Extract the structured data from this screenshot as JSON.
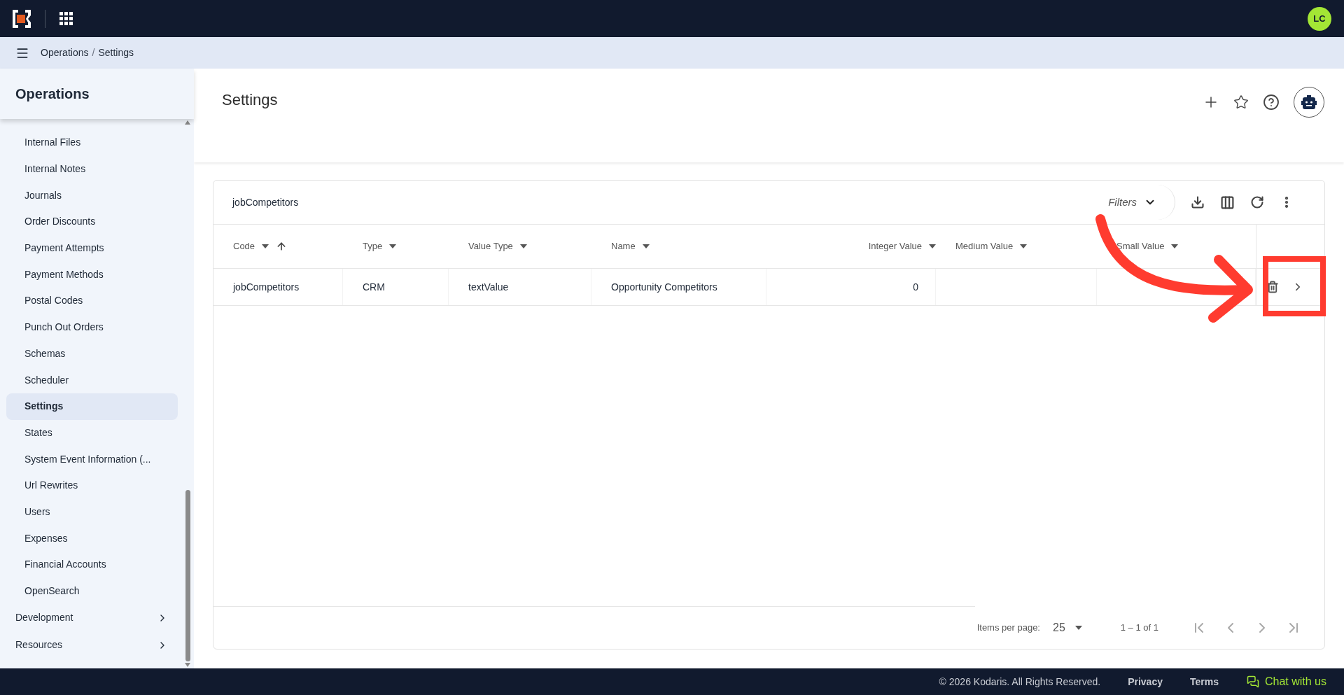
{
  "topbar": {
    "avatar": "LC"
  },
  "breadcrumb": {
    "items": [
      "Operations",
      "Settings"
    ],
    "separator": "/"
  },
  "sidebar": {
    "title": "Operations",
    "items": [
      {
        "label": "Internal Files",
        "selected": false
      },
      {
        "label": "Internal Notes",
        "selected": false
      },
      {
        "label": "Journals",
        "selected": false
      },
      {
        "label": "Order Discounts",
        "selected": false
      },
      {
        "label": "Payment Attempts",
        "selected": false
      },
      {
        "label": "Payment Methods",
        "selected": false
      },
      {
        "label": "Postal Codes",
        "selected": false
      },
      {
        "label": "Punch Out Orders",
        "selected": false
      },
      {
        "label": "Schemas",
        "selected": false
      },
      {
        "label": "Scheduler",
        "selected": false
      },
      {
        "label": "Settings",
        "selected": true
      },
      {
        "label": "States",
        "selected": false
      },
      {
        "label": "System Event Information (...",
        "selected": false
      },
      {
        "label": "Url Rewrites",
        "selected": false
      },
      {
        "label": "Users",
        "selected": false
      },
      {
        "label": "Expenses",
        "selected": false
      },
      {
        "label": "Financial Accounts",
        "selected": false
      },
      {
        "label": "OpenSearch",
        "selected": false
      }
    ],
    "sections": [
      {
        "label": "Development",
        "expanded": false
      },
      {
        "label": "Resources",
        "expanded": false
      }
    ]
  },
  "page": {
    "title": "Settings"
  },
  "table": {
    "title": "jobCompetitors",
    "filters": "Filters",
    "columns": [
      {
        "label": "Code",
        "sorted": true,
        "kind": "text"
      },
      {
        "label": "Type",
        "sorted": false,
        "kind": "text"
      },
      {
        "label": "Value Type",
        "sorted": false,
        "kind": "text"
      },
      {
        "label": "Name",
        "sorted": false,
        "kind": "text"
      },
      {
        "label": "Integer Value",
        "sorted": false,
        "kind": "number"
      },
      {
        "label": "Medium Value",
        "sorted": false,
        "kind": "text"
      },
      {
        "label": "Small Value",
        "sorted": false,
        "kind": "text"
      }
    ],
    "rows": [
      {
        "cells": [
          "jobCompetitors",
          "CRM",
          "textValue",
          "Opportunity Competitors",
          "0",
          "",
          ""
        ]
      }
    ],
    "pagination": {
      "label": "Items per page:",
      "page_size": "25",
      "range": "1 – 1 of 1"
    }
  },
  "footer": {
    "copyright": "© 2026 Kodaris. All Rights Reserved.",
    "links": [
      "Privacy",
      "Terms"
    ],
    "chat": "Chat with us"
  }
}
